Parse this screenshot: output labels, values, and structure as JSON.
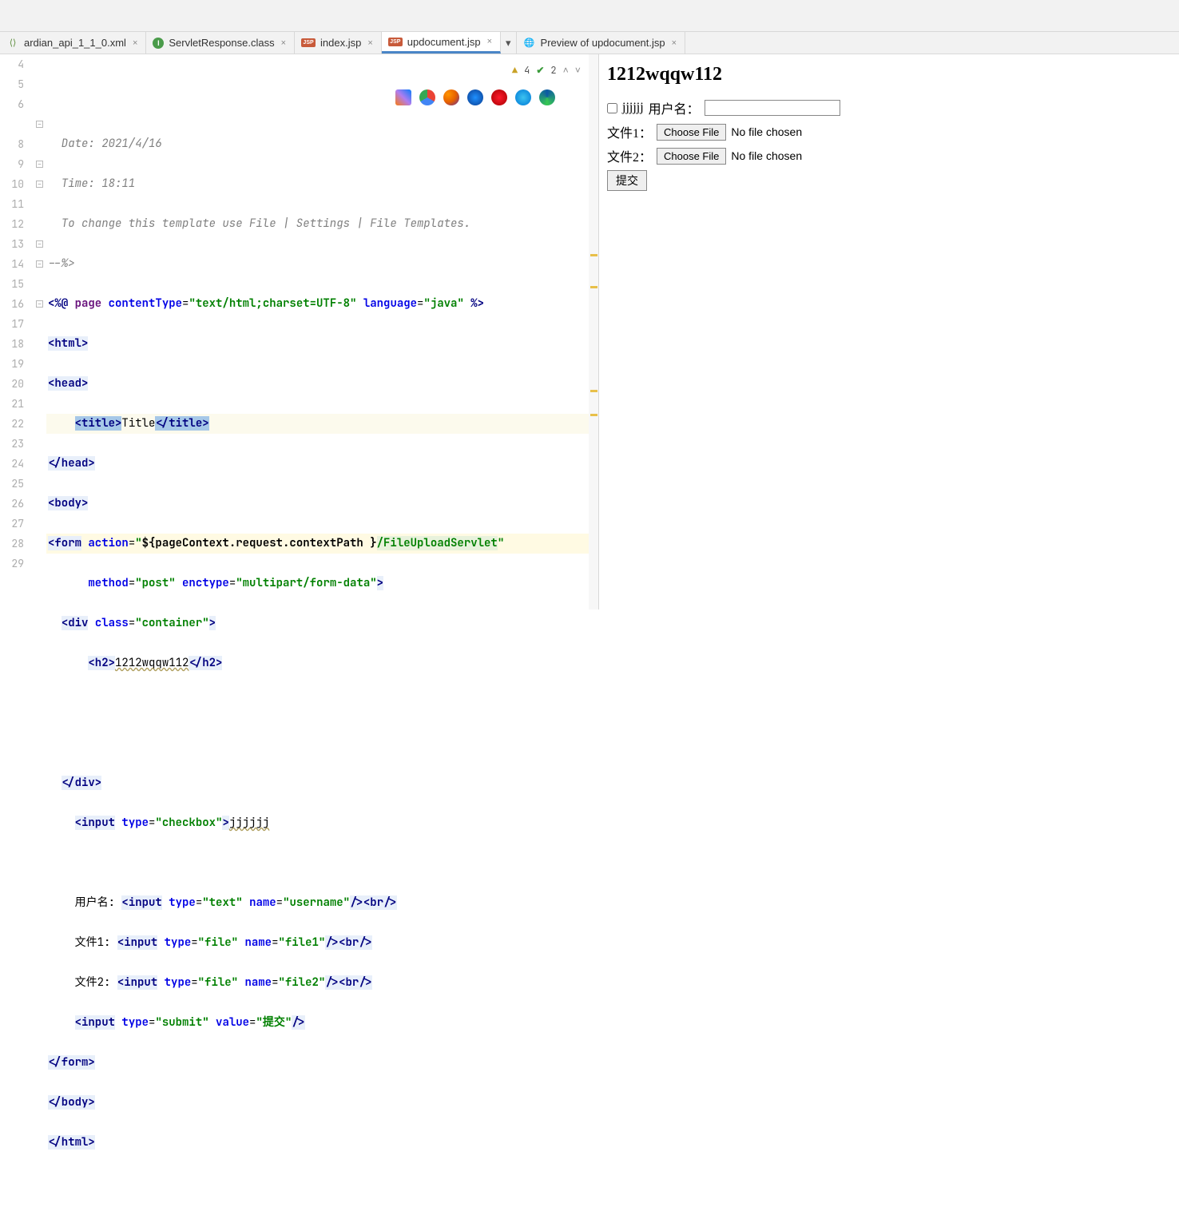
{
  "tabs": [
    {
      "label": "ardian_api_1_1_0.xml",
      "icon": "xml",
      "closable": true
    },
    {
      "label": "ServletResponse.class",
      "icon": "class",
      "closable": true
    },
    {
      "label": "index.jsp",
      "icon": "jsp",
      "closable": true
    },
    {
      "label": "updocument.jsp",
      "icon": "jsp",
      "closable": true,
      "active": true
    },
    {
      "label": "Preview of updocument.jsp",
      "icon": "globe",
      "closable": true
    }
  ],
  "gutter_start": 4,
  "gutter_lines": [
    "4",
    "5",
    "6",
    "",
    "8",
    "9",
    "10",
    "11",
    "12",
    "13",
    "14",
    "15",
    "16",
    "17",
    "18",
    "19",
    "20",
    "21",
    "22",
    "23",
    "24",
    "25",
    "26",
    "27",
    "28",
    "29"
  ],
  "inspections": {
    "warnings": "4",
    "passes": "2"
  },
  "code": {
    "l4": "  Date: 2021/4/16",
    "l5": "  Time: 18:11",
    "l6": "  To change this template use File | Settings | File Templates.",
    "l7": "--%>",
    "page_kw": "page",
    "ct_attr": "contentType",
    "ct_val": "\"text/html;charset=UTF-8\"",
    "lang_attr": "language",
    "lang_val": "\"java\"",
    "html_o": "<html>",
    "html_c": "</html>",
    "head_o": "<head>",
    "head_c": "</head>",
    "title_o": "<title>",
    "title_txt": "Title",
    "title_c": "</title>",
    "body_o": "<body>",
    "body_c": "</body>",
    "form_o": "<form",
    "action_attr": "action",
    "action_el": "${pageContext.request.contextPath }",
    "action_path": "/FileUploadServlet",
    "method_attr": "method",
    "method_val": "\"post\"",
    "enctype_attr": "enctype",
    "enctype_val": "\"multipart/form-data\"",
    "div_o": "<div",
    "class_attr": "class",
    "container_val": "\"container\"",
    "h2_o": "<h2>",
    "h2_txt": "1212wqqw112",
    "h2_c": "</h2>",
    "div_c": "</div>",
    "input": "<input",
    "type_attr": "type",
    "checkbox_val": "\"checkbox\"",
    "cbtxt": "jjjjjj",
    "user_lbl": "用户名:",
    "text_val": "\"text\"",
    "name_attr": "name",
    "username_val": "\"username\"",
    "file1_lbl": "文件1:",
    "file_val": "\"file\"",
    "file1_name": "\"file1\"",
    "file2_lbl": "文件2:",
    "file2_name": "\"file2\"",
    "submit_val": "\"submit\"",
    "value_attr": "value",
    "submit_lbl": "\"提交\"",
    "br": "<br/>",
    "form_c": "</form>"
  },
  "preview": {
    "heading": "1212wqqw112",
    "cb_label": "jjjjjj",
    "user_label": "用户名：",
    "file1_label": "文件1：",
    "file2_label": "文件2：",
    "choose_btn": "Choose File",
    "no_file": "No file chosen",
    "submit": "提交"
  }
}
